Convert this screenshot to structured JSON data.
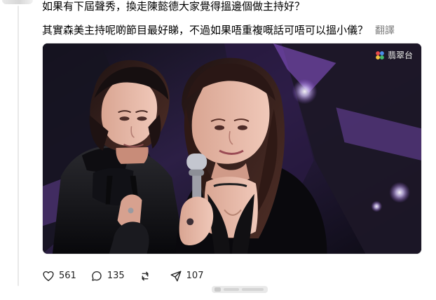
{
  "post": {
    "line1": "如果有下屆聲秀，換走陳懿德大家覺得搵邊個做主持好？",
    "line2": "其實森美主持呢啲節目最好睇，不過如果唔重複嘅話可唔可以搵小儀？",
    "translate": "翻譯"
  },
  "image": {
    "broadcaster_label": "翡翠台",
    "colors": {
      "background": "#12101c",
      "accent_purple": "#8f58d5",
      "light_sparkle": "#f3f0ff"
    },
    "icons": [
      "broadcaster-logo-icon",
      "microphone-icon"
    ]
  },
  "actions": {
    "likes": "561",
    "comments": "135",
    "reposts": "",
    "shares": "107"
  },
  "icons": {
    "like": "heart-icon",
    "comment": "comment-icon",
    "repost": "repost-icon",
    "share": "send-icon"
  },
  "watermark": {
    "visible": true
  }
}
